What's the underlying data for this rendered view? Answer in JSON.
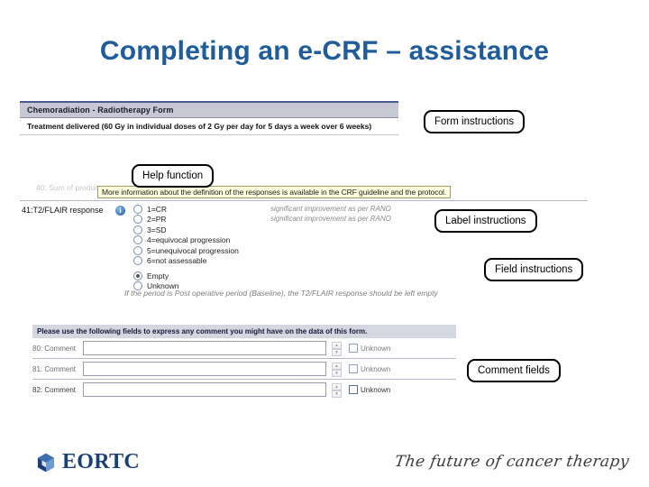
{
  "slide": {
    "title": "Completing an e-CRF – assistance"
  },
  "crf_form": {
    "header_title": "Chemoradiation - Radiotherapy Form",
    "header_subline": "Treatment delivered (60 Gy in individual doses of 2 Gy per day for 5 days a week over 6 weeks)",
    "hidden_row_text": "40: Sum of products",
    "help_tooltip": "More information about the definition of the responses is available in the CRF guideline and the protocol.",
    "question_label": "41:T2/FLAIR response",
    "info_icon": "info-icon",
    "options": [
      {
        "label": "1=CR",
        "selected": false
      },
      {
        "label": "2=PR",
        "selected": false
      },
      {
        "label": "3=SD",
        "selected": false
      },
      {
        "label": "4=equivocal progression",
        "selected": false
      },
      {
        "label": "5=unequivocal progression",
        "selected": false
      },
      {
        "label": "6=not assessable",
        "selected": false
      },
      {
        "label": "Empty",
        "selected": true
      },
      {
        "label": "Unknown",
        "selected": false
      }
    ],
    "label_instructions": [
      "significant improvement as per RANO",
      "significant improvement as per RANO"
    ],
    "field_instruction": "If the period is Post operative period (Baseline), the T2/FLAIR response should be left empty",
    "comment_banner": "Please use the following fields to express any comment you might have on the data of this form.",
    "comment_rows": [
      {
        "label": "80: Comment",
        "value": "",
        "unknown_label": "Unknown",
        "unknown_checked": false
      },
      {
        "label": "81: Comment",
        "value": "",
        "unknown_label": "Unknown",
        "unknown_checked": false
      },
      {
        "label": "82: Comment",
        "value": "",
        "unknown_label": "Unknown",
        "unknown_checked": false
      }
    ],
    "spinner_up": "▲",
    "spinner_down": "▼"
  },
  "callouts": {
    "form_instructions": "Form instructions",
    "help_function": "Help function",
    "label_instructions": "Label instructions",
    "field_instructions": "Field instructions",
    "comment_fields": "Comment fields"
  },
  "footer": {
    "logo_text": "EORTC",
    "tagline": "The future of cancer therapy",
    "logo_color": "#1b3f78"
  }
}
